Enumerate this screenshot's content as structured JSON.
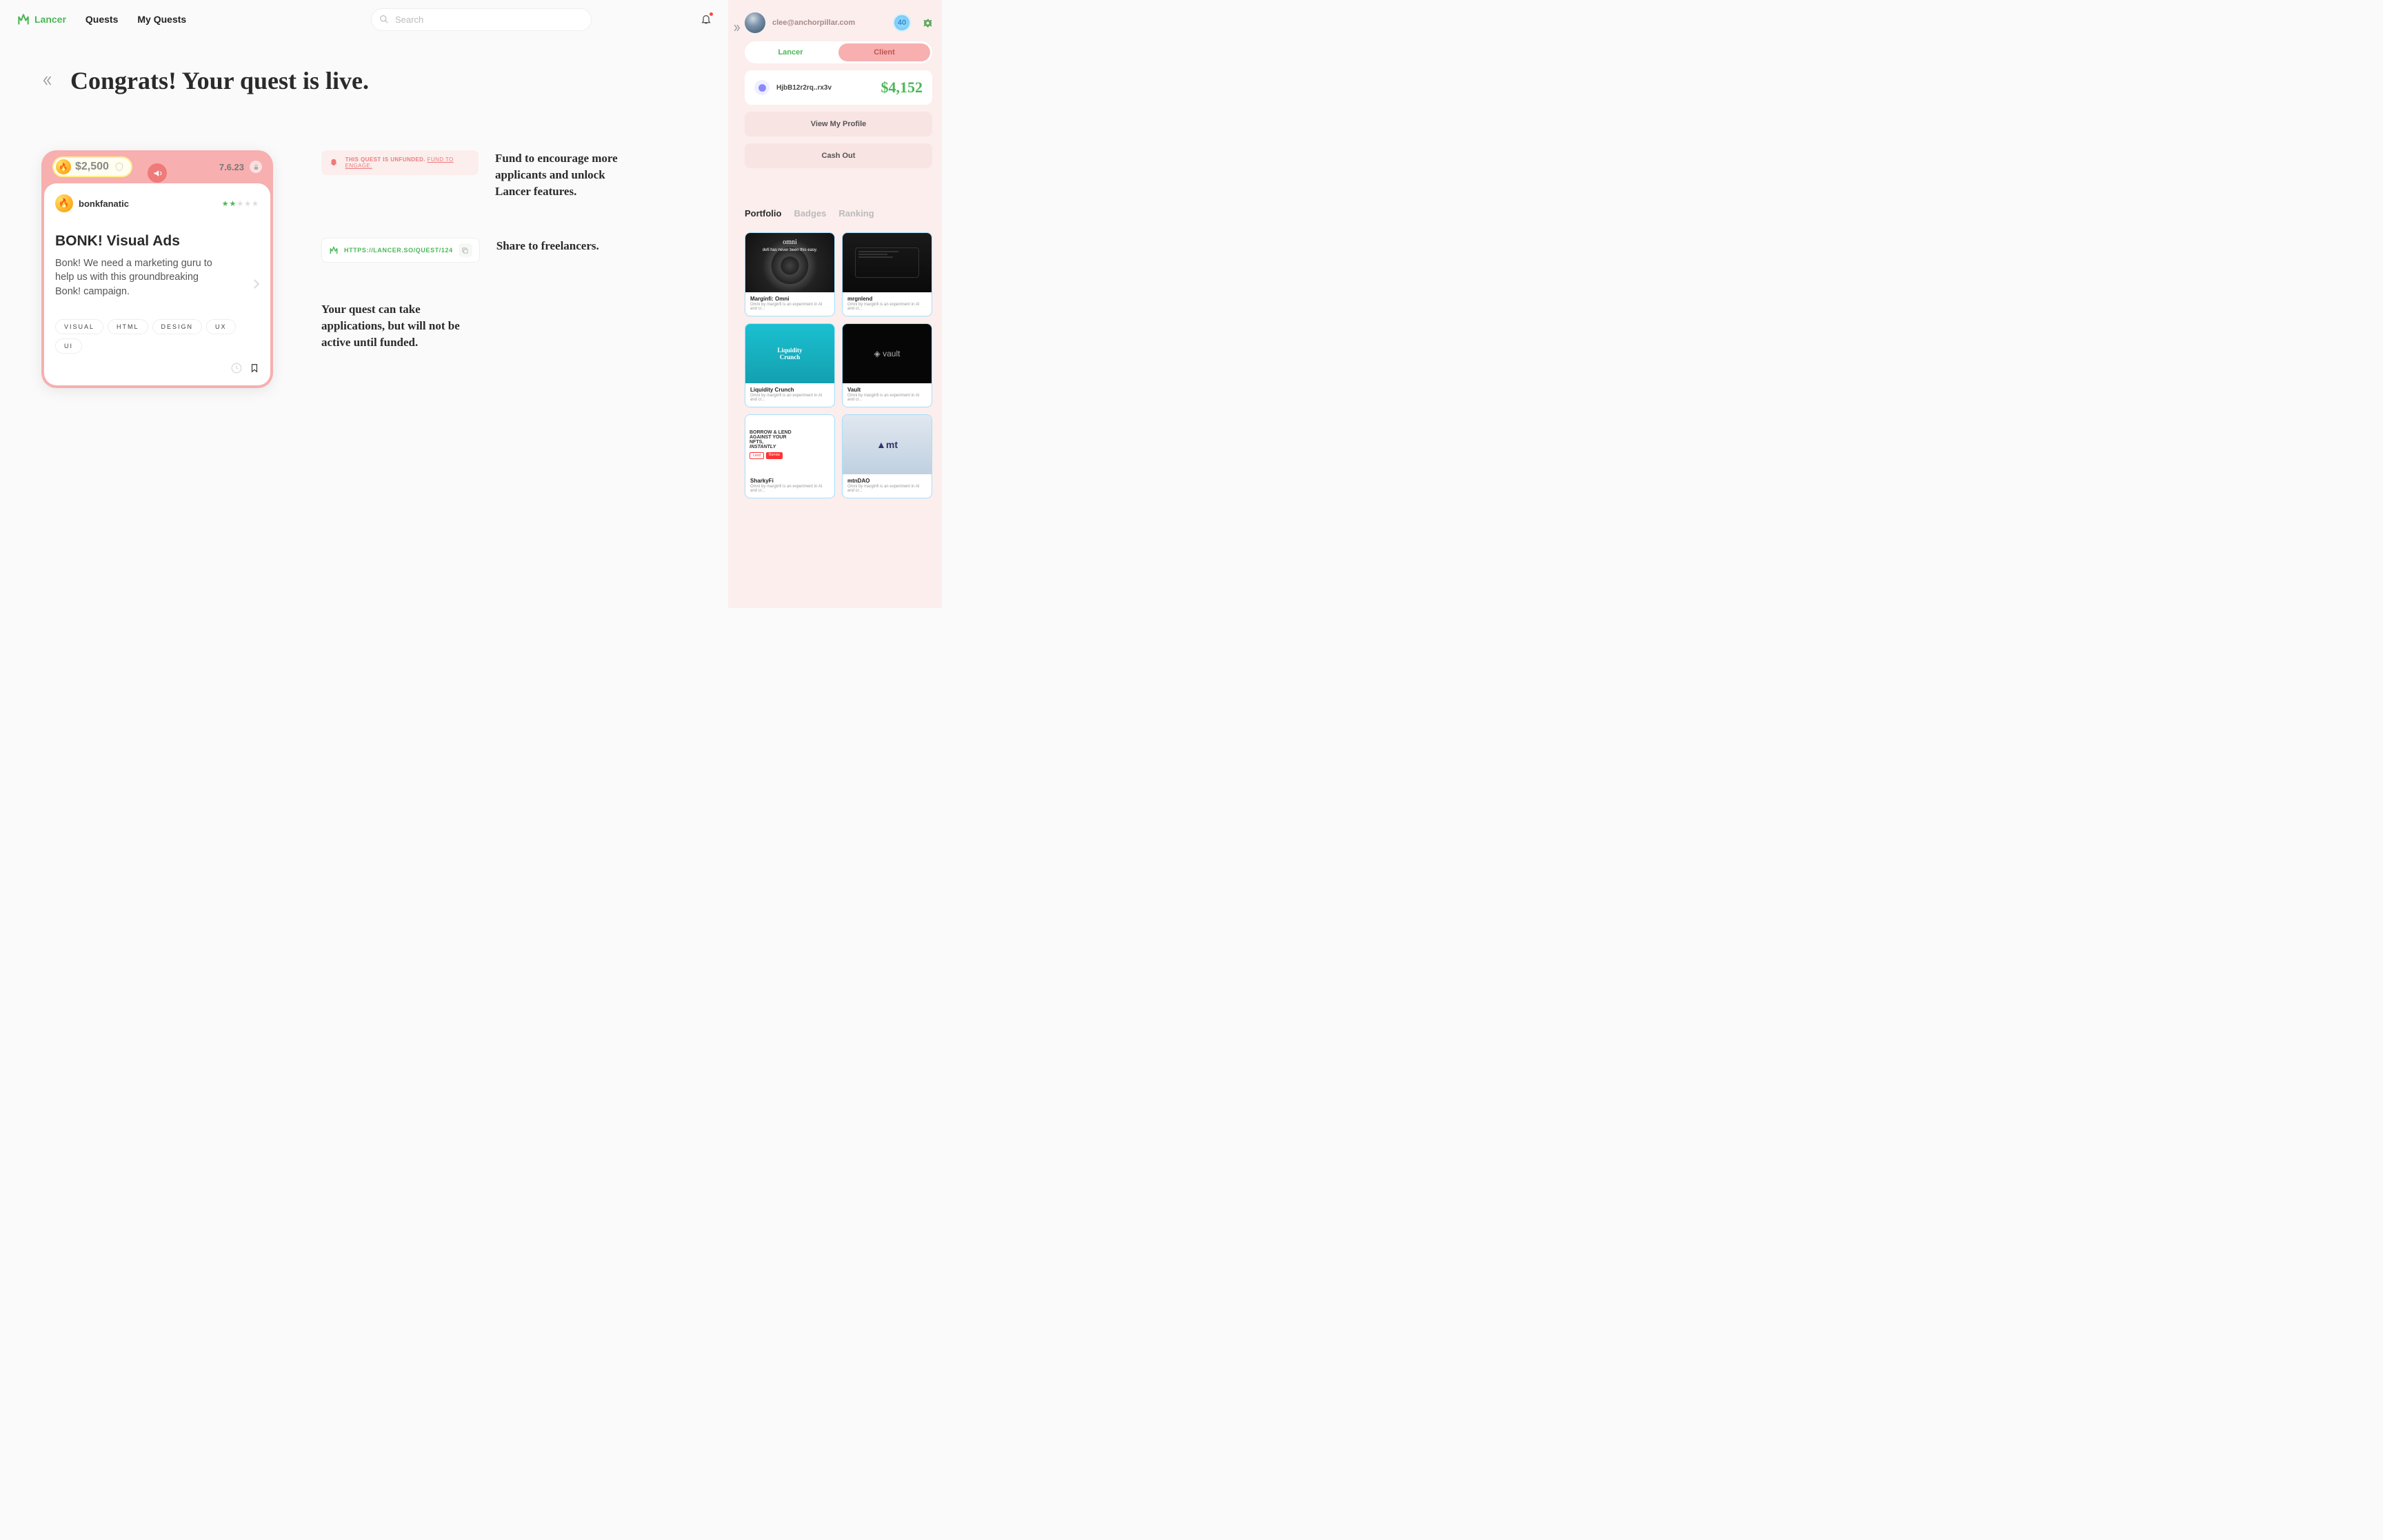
{
  "brand": "Lancer",
  "nav": {
    "quests": "Quests",
    "myQuests": "My Quests"
  },
  "search": {
    "placeholder": "Search"
  },
  "page": {
    "title": "Congrats! Your quest is live."
  },
  "quest": {
    "bounty": "$2,500",
    "date": "7.6.23",
    "author": "bonkfanatic",
    "starsOn": 2,
    "starsOff": 3,
    "title": "BONK! Visual Ads",
    "description": "Bonk! We need a marketing guru to help us with this groundbreaking Bonk! campaign.",
    "tags": [
      "VISUAL",
      "HTML",
      "DESIGN",
      "UX",
      "UI"
    ]
  },
  "alert": {
    "prefix": "THIS QUEST IS UNFUNDED. ",
    "link": "FUND TO ENGAGE."
  },
  "shareLink": "HTTPS://LANCER.SO/QUEST/124",
  "info": {
    "fund": "Fund to encourage more applicants and unlock Lancer features.",
    "share": "Share to freelancers.",
    "inactive": "Your quest can take applications, but will not be active until funded."
  },
  "sidebar": {
    "email": "clee@anchorpillar.com",
    "level": "40",
    "roles": {
      "lancer": "Lancer",
      "client": "Client"
    },
    "wallet": {
      "addr": "HjbB12r2rq..rx3v",
      "balance": "$4,152"
    },
    "buttons": {
      "profile": "View My Profile",
      "cashout": "Cash Out"
    },
    "tabs": {
      "portfolio": "Portfolio",
      "badges": "Badges",
      "ranking": "Ranking"
    },
    "portfolio": [
      {
        "title": "Marginfi: Omni",
        "sub": "Omni by marginfi is an experiment in AI and cr..."
      },
      {
        "title": "mrgnlend",
        "sub": "Omni by marginfi is an experiment in AI and cr..."
      },
      {
        "title": "Liquidity Crunch",
        "sub": "Omni by marginfi is an experiment in AI and cr..."
      },
      {
        "title": "Vault",
        "sub": "Omni by marginfi is an experiment in AI and cr..."
      },
      {
        "title": "SharkyFi",
        "sub": "Omni by marginfi is an experiment in AI and cr..."
      },
      {
        "title": "mtnDAO",
        "sub": "Omni by marginfi is an experiment in AI and cr..."
      }
    ]
  }
}
